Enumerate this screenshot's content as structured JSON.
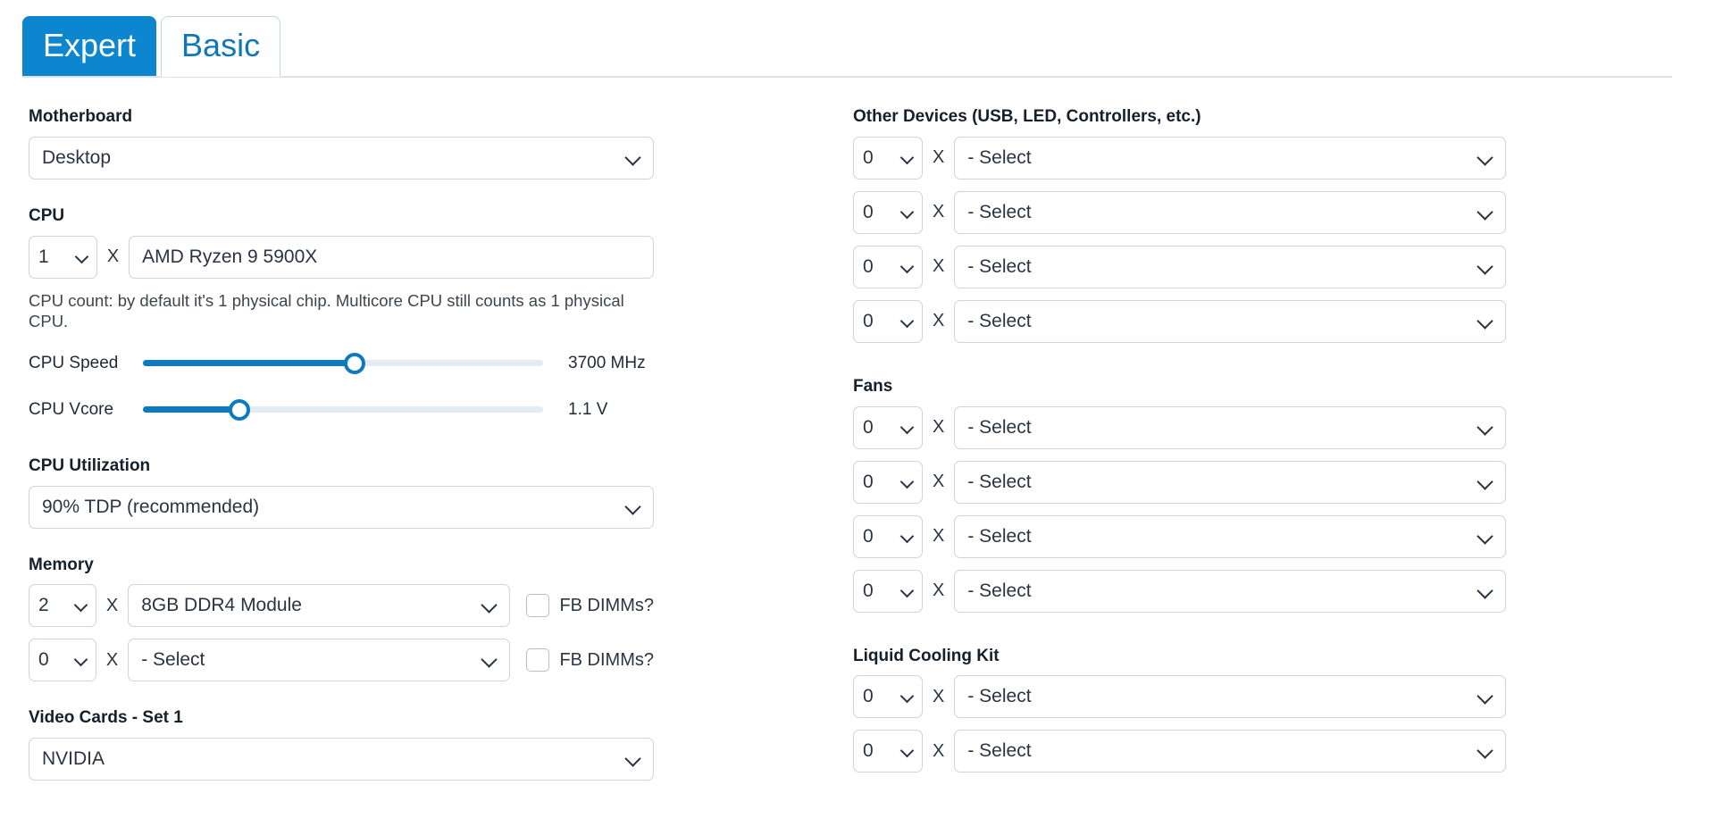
{
  "theme": {
    "accent": "#0d86d0",
    "link": "#1079b5",
    "border": "#ced4da",
    "text": "#2b3442",
    "slider_fill": "#0d7ac0",
    "slider_track": "#e3ecf3"
  },
  "tabs": [
    {
      "label": "Expert",
      "active": true
    },
    {
      "label": "Basic",
      "active": false
    }
  ],
  "left": {
    "motherboard": {
      "label": "Motherboard",
      "value": "Desktop"
    },
    "cpu": {
      "label": "CPU",
      "qty": "1",
      "multiplier": "X",
      "model": "AMD Ryzen 9 5900X",
      "hint": "CPU count: by default it's 1 physical chip. Multicore CPU still counts as 1 physical CPU.",
      "speed": {
        "label": "CPU Speed",
        "value": "3700 MHz",
        "percent": 53
      },
      "vcore": {
        "label": "CPU Vcore",
        "value": "1.1 V",
        "percent": 24
      }
    },
    "cpu_utilization": {
      "label": "CPU Utilization",
      "value": "90% TDP (recommended)"
    },
    "memory": {
      "label": "Memory",
      "multiplier": "X",
      "rows": [
        {
          "qty": "2",
          "module": "8GB DDR4 Module",
          "fb_label": "FB DIMMs?",
          "fb_checked": false
        },
        {
          "qty": "0",
          "module": "- Select",
          "fb_label": "FB DIMMs?",
          "fb_checked": false
        }
      ]
    },
    "video_cards": {
      "label": "Video Cards - Set 1",
      "value": "NVIDIA"
    }
  },
  "right": {
    "other_devices": {
      "label": "Other Devices (USB, LED, Controllers, etc.)",
      "multiplier": "X",
      "rows": [
        {
          "qty": "0",
          "value": "- Select"
        },
        {
          "qty": "0",
          "value": "- Select"
        },
        {
          "qty": "0",
          "value": "- Select"
        },
        {
          "qty": "0",
          "value": "- Select"
        }
      ]
    },
    "fans": {
      "label": "Fans",
      "multiplier": "X",
      "rows": [
        {
          "qty": "0",
          "value": "- Select"
        },
        {
          "qty": "0",
          "value": "- Select"
        },
        {
          "qty": "0",
          "value": "- Select"
        },
        {
          "qty": "0",
          "value": "- Select"
        }
      ]
    },
    "liquid_cooling": {
      "label": "Liquid Cooling Kit",
      "multiplier": "X",
      "rows": [
        {
          "qty": "0",
          "value": "- Select"
        },
        {
          "qty": "0",
          "value": "- Select"
        }
      ]
    }
  }
}
